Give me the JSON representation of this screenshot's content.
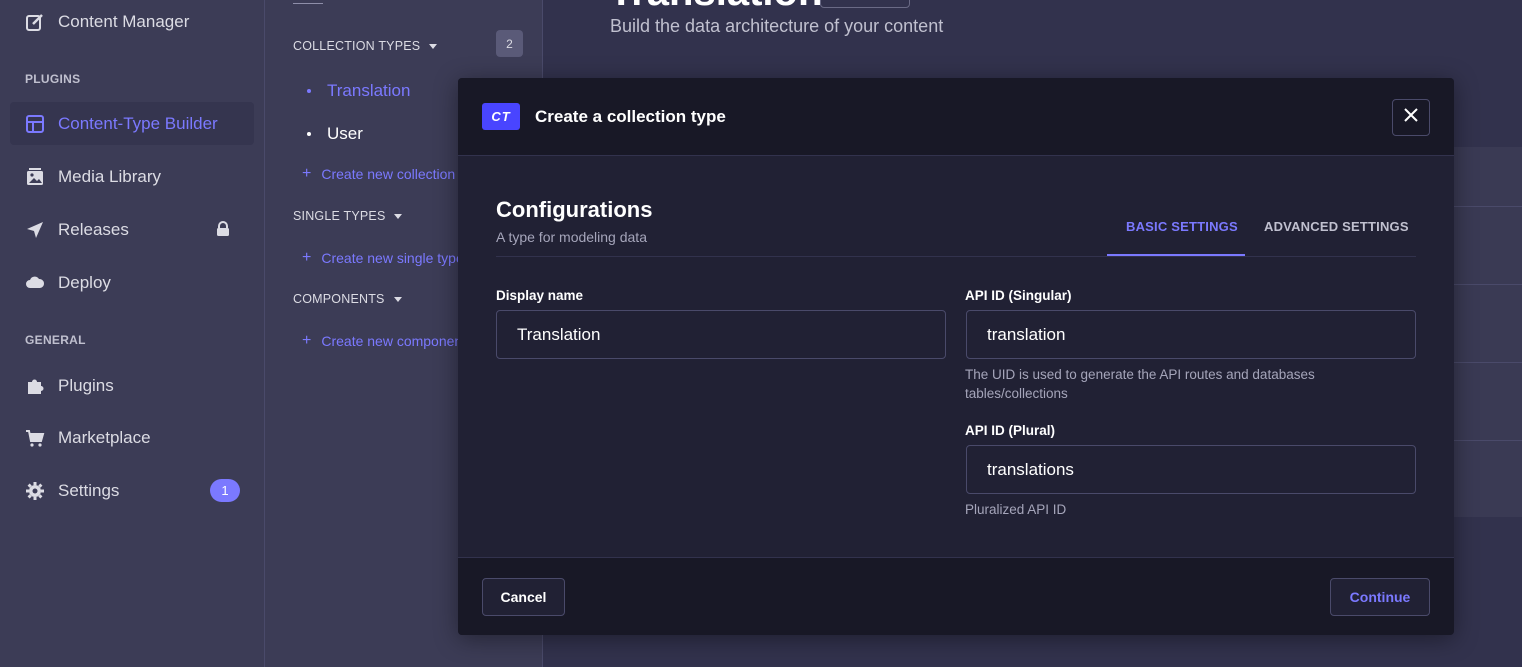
{
  "main_nav": {
    "content_manager": "Content Manager",
    "plugins_section": "PLUGINS",
    "content_type_builder": "Content-Type Builder",
    "media_library": "Media Library",
    "releases": "Releases",
    "deploy": "Deploy",
    "general_section": "GENERAL",
    "plugins": "Plugins",
    "marketplace": "Marketplace",
    "settings": "Settings",
    "settings_badge": "1"
  },
  "sub_nav": {
    "collection_types": "COLLECTION TYPES",
    "collection_count": "2",
    "collections": [
      {
        "label": "Translation",
        "active": true
      },
      {
        "label": "User",
        "active": false
      }
    ],
    "create_collection": "Create new collection type",
    "single_types": "SINGLE TYPES",
    "create_single": "Create new single type",
    "components": "COMPONENTS",
    "create_component": "Create new component"
  },
  "main": {
    "title": "Translation",
    "subtitle": "Build the data architecture of your content"
  },
  "modal": {
    "badge": "CT",
    "title": "Create a collection type",
    "section_title": "Configurations",
    "section_subtitle": "A type for modeling data",
    "tabs": {
      "basic": "BASIC SETTINGS",
      "advanced": "ADVANCED SETTINGS"
    },
    "display_name": {
      "label": "Display name",
      "value": "Translation"
    },
    "api_singular": {
      "label": "API ID (Singular)",
      "value": "translation",
      "hint": "The UID is used to generate the API routes and databases tables/collections"
    },
    "api_plural": {
      "label": "API ID (Plural)",
      "value": "translations",
      "hint": "Pluralized API ID"
    },
    "cancel": "Cancel",
    "continue": "Continue"
  },
  "colors": {
    "accent": "#7b79ff",
    "primary": "#4945ff",
    "modal_bg": "#212134",
    "sidebar_bg": "#3c3c56"
  }
}
